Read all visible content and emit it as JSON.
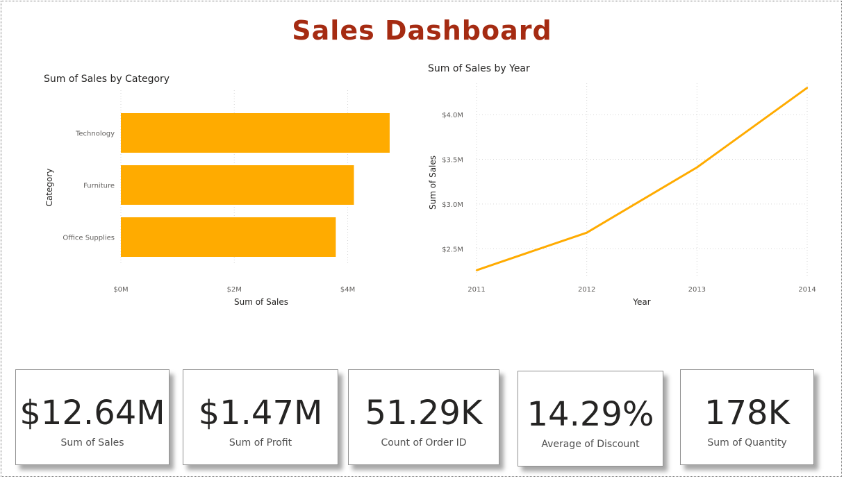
{
  "dashboard": {
    "title": "Sales Dashboard"
  },
  "colors": {
    "accent": "#ffab00",
    "title": "#a52b12"
  },
  "kpis": [
    {
      "value": "$12.64M",
      "label": "Sum of Sales"
    },
    {
      "value": "$1.47M",
      "label": "Sum of Profit"
    },
    {
      "value": "51.29K",
      "label": "Count of Order ID"
    },
    {
      "value": "14.29%",
      "label": "Average of Discount"
    },
    {
      "value": "178K",
      "label": "Sum of Quantity"
    }
  ],
  "chart_data": [
    {
      "type": "bar",
      "orientation": "horizontal",
      "title": "Sum of Sales by Category",
      "xlabel": "Sum of Sales",
      "ylabel": "Category",
      "categories": [
        "Technology",
        "Furniture",
        "Office Supplies"
      ],
      "values": [
        4.74,
        4.11,
        3.79
      ],
      "xlim": [
        0,
        4.9
      ],
      "xticks": [
        0,
        2,
        4
      ],
      "xtick_labels": [
        "$0M",
        "$2M",
        "$4M"
      ],
      "grid": true
    },
    {
      "type": "line",
      "title": "Sum of Sales by Year",
      "xlabel": "Year",
      "ylabel": "Sum of Sales",
      "x": [
        2011,
        2012,
        2013,
        2014
      ],
      "values": [
        2.26,
        2.68,
        3.41,
        4.3
      ],
      "ylim": [
        2.2,
        4.35
      ],
      "yticks": [
        2.5,
        3.0,
        3.5,
        4.0
      ],
      "ytick_labels": [
        "$2.5M",
        "$3.0M",
        "$3.5M",
        "$4.0M"
      ],
      "xtick_labels": [
        "2011",
        "2012",
        "2013",
        "2014"
      ],
      "grid": true
    }
  ]
}
